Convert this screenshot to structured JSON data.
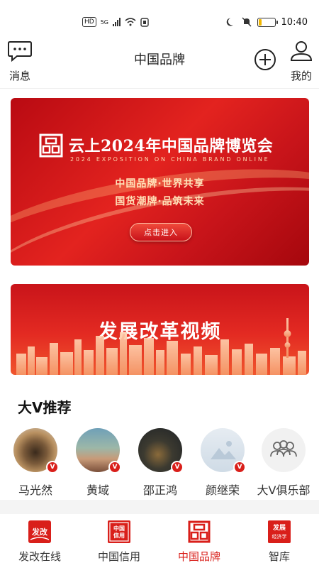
{
  "status_bar": {
    "network_badge": "HD",
    "signal_label": "5G",
    "time": "10:40",
    "battery_level": 0.2
  },
  "header": {
    "messages_label": "消息",
    "title": "中国品牌",
    "profile_label": "我的"
  },
  "banner_expo": {
    "title": "云上2024年中国品牌博览会",
    "subtitle": "2024 EXPOSITION ON CHINA BRAND ONLINE",
    "slogan_1": "中国品牌·世界共享",
    "slogan_2": "国货潮牌·品筑未来",
    "button_label": "点击进入"
  },
  "banner_video": {
    "title": "发展改革视频"
  },
  "section": {
    "title": "大V推荐"
  },
  "people": [
    {
      "name": "马光然",
      "verified_mark": "V"
    },
    {
      "name": "黄域",
      "verified_mark": "V"
    },
    {
      "name": "邵正鸿",
      "verified_mark": "V"
    },
    {
      "name": "颜继荣",
      "verified_mark": "V"
    },
    {
      "name": "大V俱乐部"
    }
  ],
  "bottom_nav": [
    {
      "label": "发改在线",
      "icon_text": "发改"
    },
    {
      "label": "中国信用",
      "icon_text_1": "中国",
      "icon_text_2": "信用"
    },
    {
      "label": "中国品牌",
      "active": true
    },
    {
      "label": "智库",
      "icon_text_1": "发展",
      "icon_text_2": "经济学"
    }
  ],
  "colors": {
    "brand_red": "#d91f1a",
    "battery": "#f2b700"
  }
}
